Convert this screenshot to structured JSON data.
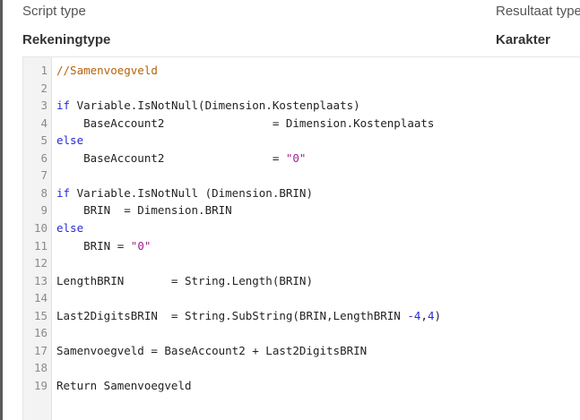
{
  "header": {
    "script_type_label": "Script type",
    "script_type_value": "Rekeningtype",
    "result_type_label": "Resultaat type",
    "result_type_value": "Karakter"
  },
  "editor": {
    "lines": [
      {
        "n": "1",
        "parts": [
          {
            "t": "//Samenvoegveld",
            "c": "cmt"
          }
        ]
      },
      {
        "n": "2",
        "parts": []
      },
      {
        "n": "3",
        "parts": [
          {
            "t": "if",
            "c": "kw"
          },
          {
            "t": " Variable.IsNotNull(Dimension.Kostenplaats)",
            "c": ""
          }
        ]
      },
      {
        "n": "4",
        "parts": [
          {
            "t": "    BaseAccount2                = Dimension.Kostenplaats",
            "c": ""
          }
        ]
      },
      {
        "n": "5",
        "parts": [
          {
            "t": "else",
            "c": "kw"
          }
        ]
      },
      {
        "n": "6",
        "parts": [
          {
            "t": "    BaseAccount2                = ",
            "c": ""
          },
          {
            "t": "\"0\"",
            "c": "str"
          }
        ]
      },
      {
        "n": "7",
        "parts": []
      },
      {
        "n": "8",
        "parts": [
          {
            "t": "if",
            "c": "kw"
          },
          {
            "t": " Variable.IsNotNull (Dimension.BRIN)",
            "c": ""
          }
        ]
      },
      {
        "n": "9",
        "parts": [
          {
            "t": "    BRIN  = Dimension.BRIN",
            "c": ""
          }
        ]
      },
      {
        "n": "10",
        "parts": [
          {
            "t": "else",
            "c": "kw"
          }
        ]
      },
      {
        "n": "11",
        "parts": [
          {
            "t": "    BRIN = ",
            "c": ""
          },
          {
            "t": "\"0\"",
            "c": "str"
          }
        ]
      },
      {
        "n": "12",
        "parts": []
      },
      {
        "n": "13",
        "parts": [
          {
            "t": "LengthBRIN       = String.Length(BRIN)",
            "c": ""
          }
        ]
      },
      {
        "n": "14",
        "parts": []
      },
      {
        "n": "15",
        "parts": [
          {
            "t": "Last2DigitsBRIN  = String.SubString(BRIN,LengthBRIN ",
            "c": ""
          },
          {
            "t": "-4",
            "c": "num"
          },
          {
            "t": ",",
            "c": ""
          },
          {
            "t": "4",
            "c": "num"
          },
          {
            "t": ")",
            "c": ""
          }
        ]
      },
      {
        "n": "16",
        "parts": []
      },
      {
        "n": "17",
        "parts": [
          {
            "t": "Samenvoegveld = BaseAccount2 + Last2DigitsBRIN",
            "c": ""
          }
        ]
      },
      {
        "n": "18",
        "parts": []
      },
      {
        "n": "19",
        "parts": [
          {
            "t": "Return Samenvoegveld",
            "c": ""
          }
        ]
      }
    ]
  }
}
